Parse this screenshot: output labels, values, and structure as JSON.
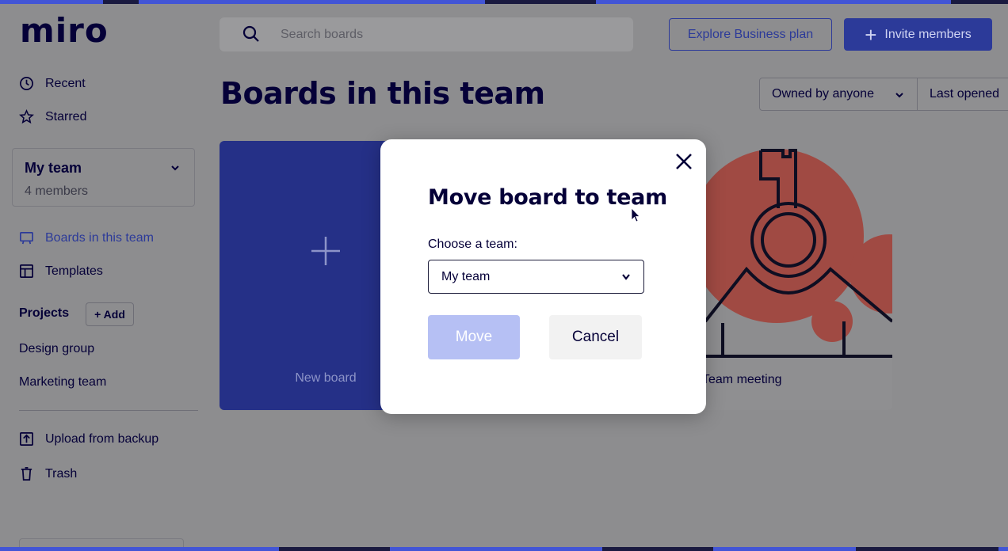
{
  "app": {
    "logo": "miro"
  },
  "header": {
    "search_placeholder": "Search boards",
    "explore_label": "Explore Business plan",
    "invite_label": "Invite members"
  },
  "sidebar": {
    "recent": "Recent",
    "starred": "Starred",
    "team": {
      "name": "My team",
      "members": "4 members"
    },
    "boards_in_team": "Boards in this team",
    "templates": "Templates",
    "projects_label": "Projects",
    "add_label": "+ Add",
    "projects": [
      "Design group",
      "Marketing team"
    ],
    "upload": "Upload from backup",
    "trash": "Trash"
  },
  "main": {
    "title": "Boards in this team",
    "filters": {
      "owner": "Owned by anyone",
      "sort": "Last opened"
    },
    "boards": [
      {
        "label": "New board"
      },
      {
        "label": "Team meeting"
      }
    ]
  },
  "modal": {
    "title": "Move board to team",
    "choose_label": "Choose a team:",
    "selected_team": "My team",
    "move_label": "Move",
    "cancel_label": "Cancel"
  },
  "colors": {
    "accent": "#4255d6",
    "brand_dark": "#050038",
    "new_board_card": "#253087",
    "move_disabled": "#b6c0f4",
    "thumbnail_red": "#a04a43"
  }
}
